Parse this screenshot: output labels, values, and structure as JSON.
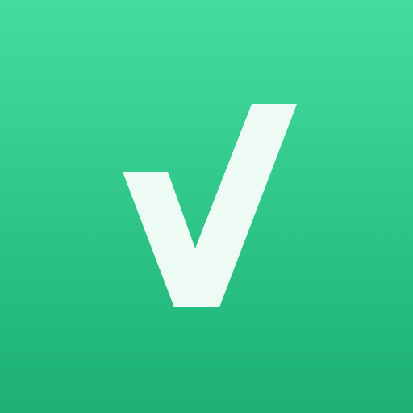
{
  "icon": {
    "name": "check-mark-icon",
    "colors": {
      "background_top": "#44DDA0",
      "background_bottom": "#1CB074",
      "mark": "#EEFAF4"
    }
  }
}
